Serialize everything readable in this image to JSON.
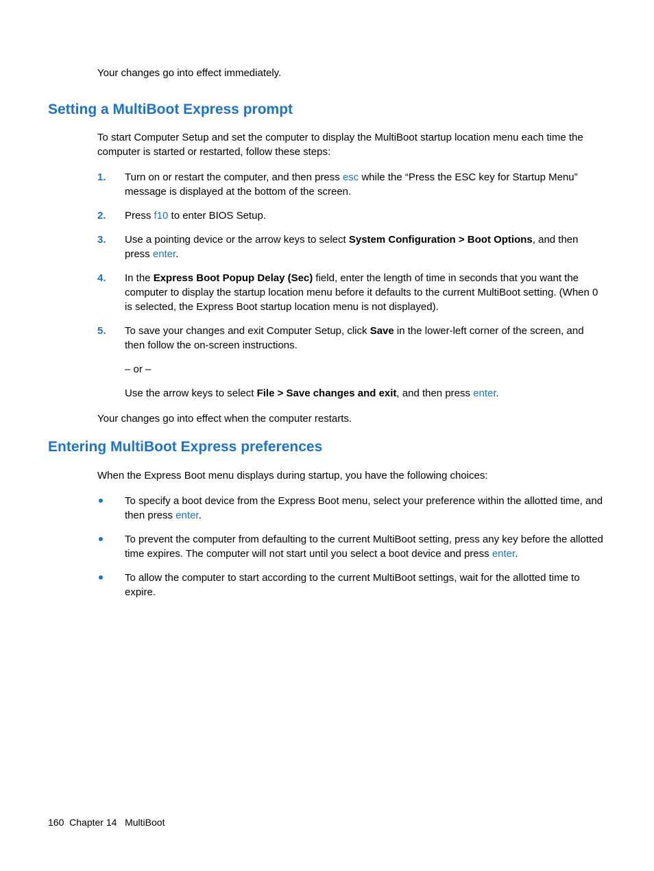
{
  "intro": "Your changes go into effect immediately.",
  "section1": {
    "heading": "Setting a MultiBoot Express prompt",
    "lead": "To start Computer Setup and set the computer to display the MultiBoot startup location menu each time the computer is started or restarted, follow these steps:",
    "steps": [
      {
        "num": "1.",
        "pre": "Turn on or restart the computer, and then press ",
        "key": "esc",
        "post": " while the “Press the ESC key for Startup Menu” message is displayed at the bottom of the screen."
      },
      {
        "num": "2.",
        "pre": "Press ",
        "key": "f10",
        "post": " to enter BIOS Setup."
      },
      {
        "num": "3.",
        "pre": "Use a pointing device or the arrow keys to select ",
        "bold": "System Configuration > Boot Options",
        "mid": ", and then press ",
        "key": "enter",
        "post": "."
      },
      {
        "num": "4.",
        "pre": "In the ",
        "bold": "Express Boot Popup Delay (Sec)",
        "post": " field, enter the length of time in seconds that you want the computer to display the startup location menu before it defaults to the current MultiBoot setting. (When 0 is selected, the Express Boot startup location menu is not displayed)."
      },
      {
        "num": "5.",
        "pre": "To save your changes and exit Computer Setup, click ",
        "bold": "Save",
        "post": " in the lower-left corner of the screen, and then follow the on-screen instructions.",
        "or": "– or –",
        "sub_pre": "Use the arrow keys to select ",
        "sub_bold": "File > Save changes and exit",
        "sub_mid": ", and then press ",
        "sub_key": "enter",
        "sub_post": "."
      }
    ],
    "tail": "Your changes go into effect when the computer restarts."
  },
  "section2": {
    "heading": "Entering MultiBoot Express preferences",
    "lead": "When the Express Boot menu displays during startup, you have the following choices:",
    "bullets": [
      {
        "pre": "To specify a boot device from the Express Boot menu, select your preference within the allotted time, and then press ",
        "key": "enter",
        "post": "."
      },
      {
        "pre": "To prevent the computer from defaulting to the current MultiBoot setting, press any key before the allotted time expires. The computer will not start until you select a boot device and press ",
        "key": "enter",
        "post": "."
      },
      {
        "pre": "To allow the computer to start according to the current MultiBoot settings, wait for the allotted time to expire.",
        "key": "",
        "post": ""
      }
    ]
  },
  "footer": {
    "page": "160",
    "chapter_label": "Chapter 14",
    "title": "MultiBoot"
  }
}
